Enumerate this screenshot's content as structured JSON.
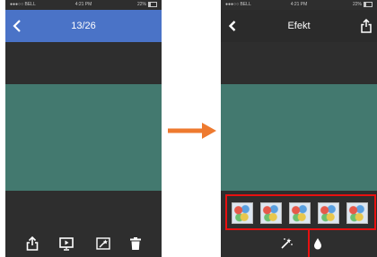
{
  "left_screen": {
    "status": {
      "carrier": "●●●○○ BELL",
      "time": "4:21 PM",
      "battery": "22%"
    },
    "counter": "13/26",
    "toolbar": [
      "share-icon",
      "slideshow-icon",
      "enhance-icon",
      "trash-icon"
    ]
  },
  "right_screen": {
    "status": {
      "carrier": "●●●○○ BELL",
      "time": "4:21 PM",
      "battery": "22%"
    },
    "title": "Efekt",
    "filter_thumbnail_count": 5,
    "bottom_tools": [
      "magic-wand-icon",
      "droplet-icon"
    ]
  },
  "colors": {
    "left_navbar": "#4a73c7",
    "right_navbar": "#2b2b2b",
    "photo": "#43796f",
    "screen_bg": "#2e2e2e",
    "arrow": "#ee7a2f",
    "highlight": "#e81010"
  }
}
